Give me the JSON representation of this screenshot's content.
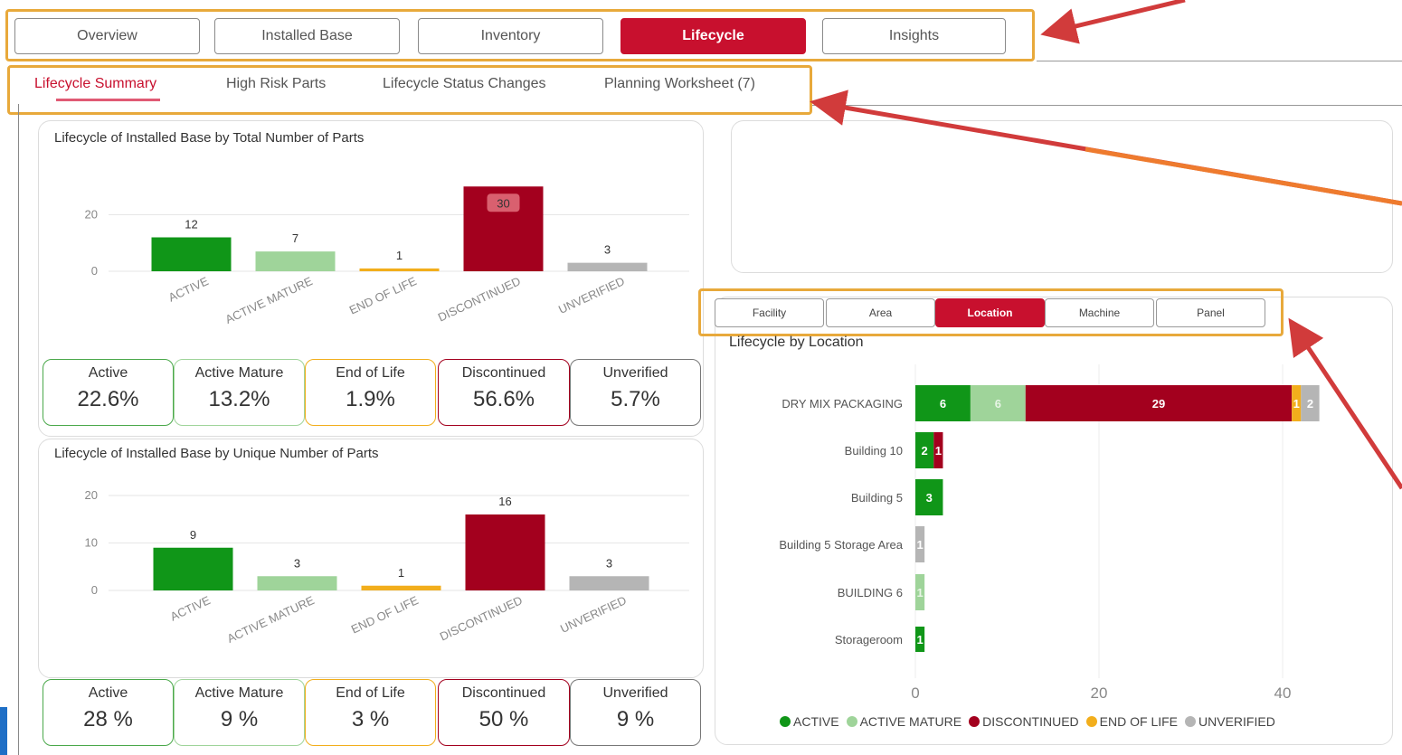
{
  "colors": {
    "active": "#109618",
    "active_mature": "#9fd49a",
    "end_of_life": "#f2ae1c",
    "discontinued": "#a3001e",
    "unverified": "#b5b5b5",
    "accent": "#c8102e",
    "annotation_red": "#d13b3b",
    "annotation_orange": "#ee7b2e",
    "highlight_box": "#e8a93b"
  },
  "top_tabs": [
    {
      "label": "Overview",
      "active": false
    },
    {
      "label": "Installed Base",
      "active": false
    },
    {
      "label": "Inventory",
      "active": false
    },
    {
      "label": "Lifecycle",
      "active": true
    },
    {
      "label": "Insights",
      "active": false
    }
  ],
  "sub_tabs": [
    {
      "label": "Lifecycle Summary",
      "active": true
    },
    {
      "label": "High Risk Parts",
      "active": false
    },
    {
      "label": "Lifecycle Status Changes",
      "active": false
    },
    {
      "label": "Planning Worksheet (7)",
      "active": false
    }
  ],
  "total_card": {
    "title": "Lifecycle of Installed Base by Total Number of Parts",
    "stats": [
      {
        "label": "Active",
        "value": "22.6%"
      },
      {
        "label": "Active Mature",
        "value": "13.2%"
      },
      {
        "label": "End of Life",
        "value": "1.9%"
      },
      {
        "label": "Discontinued",
        "value": "56.6%"
      },
      {
        "label": "Unverified",
        "value": "5.7%"
      }
    ]
  },
  "unique_card": {
    "title": "Lifecycle of Installed Base by Unique Number of Parts",
    "stats": [
      {
        "label": "Active",
        "value": "28 %"
      },
      {
        "label": "Active Mature",
        "value": "9 %"
      },
      {
        "label": "End of Life",
        "value": "3 %"
      },
      {
        "label": "Discontinued",
        "value": "50 %"
      },
      {
        "label": "Unverified",
        "value": "9 %"
      }
    ]
  },
  "location_card": {
    "buttons": [
      {
        "label": "Facility",
        "active": false
      },
      {
        "label": "Area",
        "active": false
      },
      {
        "label": "Location",
        "active": true
      },
      {
        "label": "Machine",
        "active": false
      },
      {
        "label": "Panel",
        "active": false
      }
    ],
    "title": "Lifecycle by Location",
    "legend": [
      "ACTIVE",
      "ACTIVE MATURE",
      "DISCONTINUED",
      "END OF LIFE",
      "UNVERIFIED"
    ]
  },
  "chart_data": [
    {
      "type": "bar",
      "title": "Lifecycle of Installed Base by Total Number of Parts",
      "categories": [
        "ACTIVE",
        "ACTIVE MATURE",
        "END OF LIFE",
        "DISCONTINUED",
        "UNVERIFIED"
      ],
      "values": [
        12,
        7,
        1,
        30,
        3
      ],
      "yticks": [
        0,
        20
      ],
      "ylim": [
        0,
        32
      ]
    },
    {
      "type": "bar",
      "title": "Lifecycle of Installed Base by Unique Number of Parts",
      "categories": [
        "ACTIVE",
        "ACTIVE MATURE",
        "END OF LIFE",
        "DISCONTINUED",
        "UNVERIFIED"
      ],
      "values": [
        9,
        3,
        1,
        16,
        3
      ],
      "yticks": [
        0,
        10,
        20
      ],
      "ylim": [
        0,
        20
      ]
    },
    {
      "type": "bar",
      "orientation": "horizontal",
      "stacked": true,
      "title": "Lifecycle by Location",
      "categories": [
        "DRY MIX PACKAGING",
        "Building 10",
        "Building 5",
        "Building 5 Storage Area",
        "BUILDING 6",
        "Storageroom"
      ],
      "series": [
        {
          "name": "ACTIVE",
          "values": [
            6,
            2,
            3,
            0,
            0,
            1
          ]
        },
        {
          "name": "ACTIVE MATURE",
          "values": [
            6,
            0,
            0,
            0,
            1,
            0
          ]
        },
        {
          "name": "DISCONTINUED",
          "values": [
            29,
            1,
            0,
            0,
            0,
            0
          ]
        },
        {
          "name": "END OF LIFE",
          "values": [
            1,
            0,
            0,
            0,
            0,
            0
          ]
        },
        {
          "name": "UNVERIFIED",
          "values": [
            2,
            0,
            0,
            1,
            0,
            0
          ]
        }
      ],
      "xticks": [
        0,
        20,
        40
      ],
      "xlim": [
        0,
        48
      ],
      "legend": "bottom"
    }
  ]
}
